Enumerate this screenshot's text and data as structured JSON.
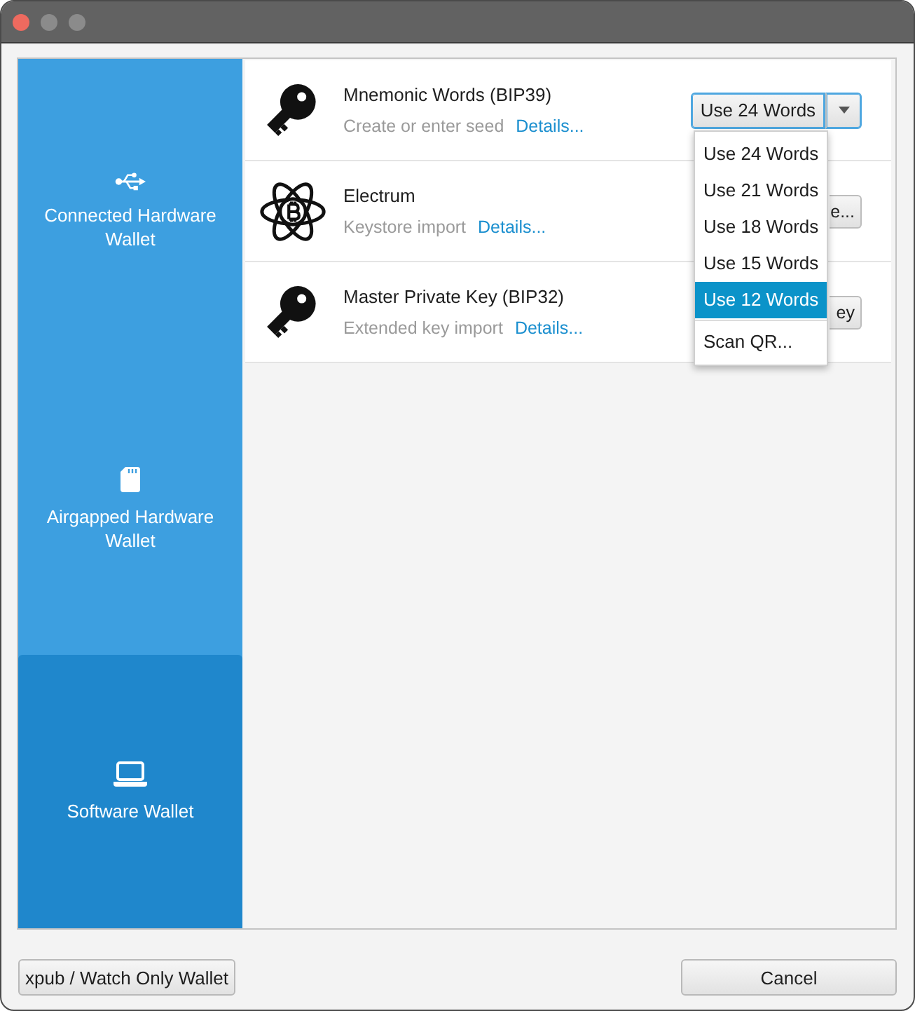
{
  "window": {
    "controls": [
      {
        "kind": "close",
        "disabled": false
      },
      {
        "kind": "minimize",
        "disabled": true
      },
      {
        "kind": "zoom",
        "disabled": true
      }
    ]
  },
  "sidebar": {
    "items": [
      {
        "label": "Connected Hardware Wallet",
        "selected": false
      },
      {
        "label": "Airgapped Hardware Wallet",
        "selected": false
      },
      {
        "label": "Software Wallet",
        "selected": true
      }
    ]
  },
  "options": [
    {
      "title": "Mnemonic Words (BIP39)",
      "description": "Create or enter seed",
      "link": "Details...",
      "action": {
        "kind": "split",
        "label": "Use 24 Words",
        "focused": true
      }
    },
    {
      "title": "Electrum",
      "description": "Keystore import",
      "link": "Details...",
      "action": {
        "kind": "button",
        "label": "e..."
      }
    },
    {
      "title": "Master Private Key (BIP32)",
      "description": "Extended key import",
      "link": "Details...",
      "action": {
        "kind": "button",
        "label": "ey"
      }
    }
  ],
  "dropdown_menu": {
    "sections": [
      {
        "items": [
          {
            "label": "Use 24 Words",
            "selected": false
          },
          {
            "label": "Use 21 Words",
            "selected": false
          },
          {
            "label": "Use 18 Words",
            "selected": false
          },
          {
            "label": "Use 15 Words",
            "selected": false
          },
          {
            "label": "Use 12 Words",
            "selected": true
          }
        ]
      },
      {
        "items": [
          {
            "label": "Scan QR...",
            "selected": false
          }
        ]
      }
    ]
  },
  "footer": {
    "buttons": [
      {
        "label": "xpub / Watch Only Wallet"
      },
      {
        "label": "Cancel"
      }
    ]
  }
}
